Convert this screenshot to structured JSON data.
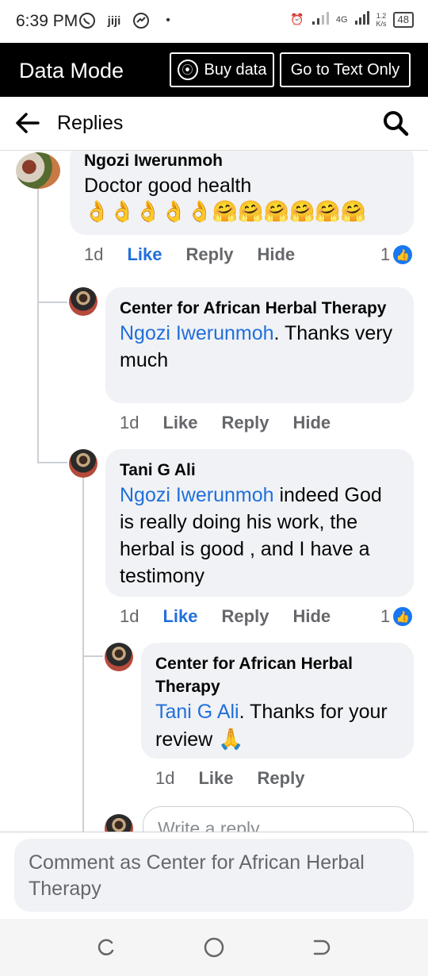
{
  "status_bar": {
    "time": "6:39 PM",
    "network": "4G",
    "speed_top": "1.2",
    "speed_bottom": "K/s",
    "battery": "48"
  },
  "data_mode": {
    "title": "Data Mode",
    "buy_label": "Buy data",
    "text_only_label": "Go to Text Only"
  },
  "header": {
    "title": "Replies"
  },
  "comments": [
    {
      "author": "Ngozi Iwerunmoh",
      "text": "Doctor good health",
      "emojis": "👌👌👌👌👌🤗🤗🤗🤗🤗🤗",
      "time": "1d",
      "like": "Like",
      "reply": "Reply",
      "hide": "Hide",
      "like_count": "1"
    },
    {
      "author": "Center for African Herbal Therapy",
      "mention": "Ngozi Iwerunmoh",
      "text": ". Thanks very much",
      "time": "1d",
      "like": "Like",
      "reply": "Reply",
      "hide": "Hide"
    },
    {
      "author": "Tani G Ali",
      "mention": "Ngozi Iwerunmoh",
      "text": " indeed God is really doing his work, the herbal is good , and I have a testimony",
      "time": "1d",
      "like": "Like",
      "reply": "Reply",
      "hide": "Hide",
      "like_count": "1"
    },
    {
      "author": "Center for African Herbal Therapy",
      "mention": "Tani G Ali",
      "text": ". Thanks for your review",
      "emoji": "🙏",
      "time": "1d",
      "like": "Like",
      "reply": "Reply"
    }
  ],
  "reply_box": {
    "placeholder": "Write a reply..."
  },
  "composer": {
    "placeholder": "Comment as Center for African Herbal Therapy"
  },
  "colors": {
    "link": "#216fdb",
    "like_badge": "#1877f2",
    "bubble": "#f0f2f5"
  }
}
